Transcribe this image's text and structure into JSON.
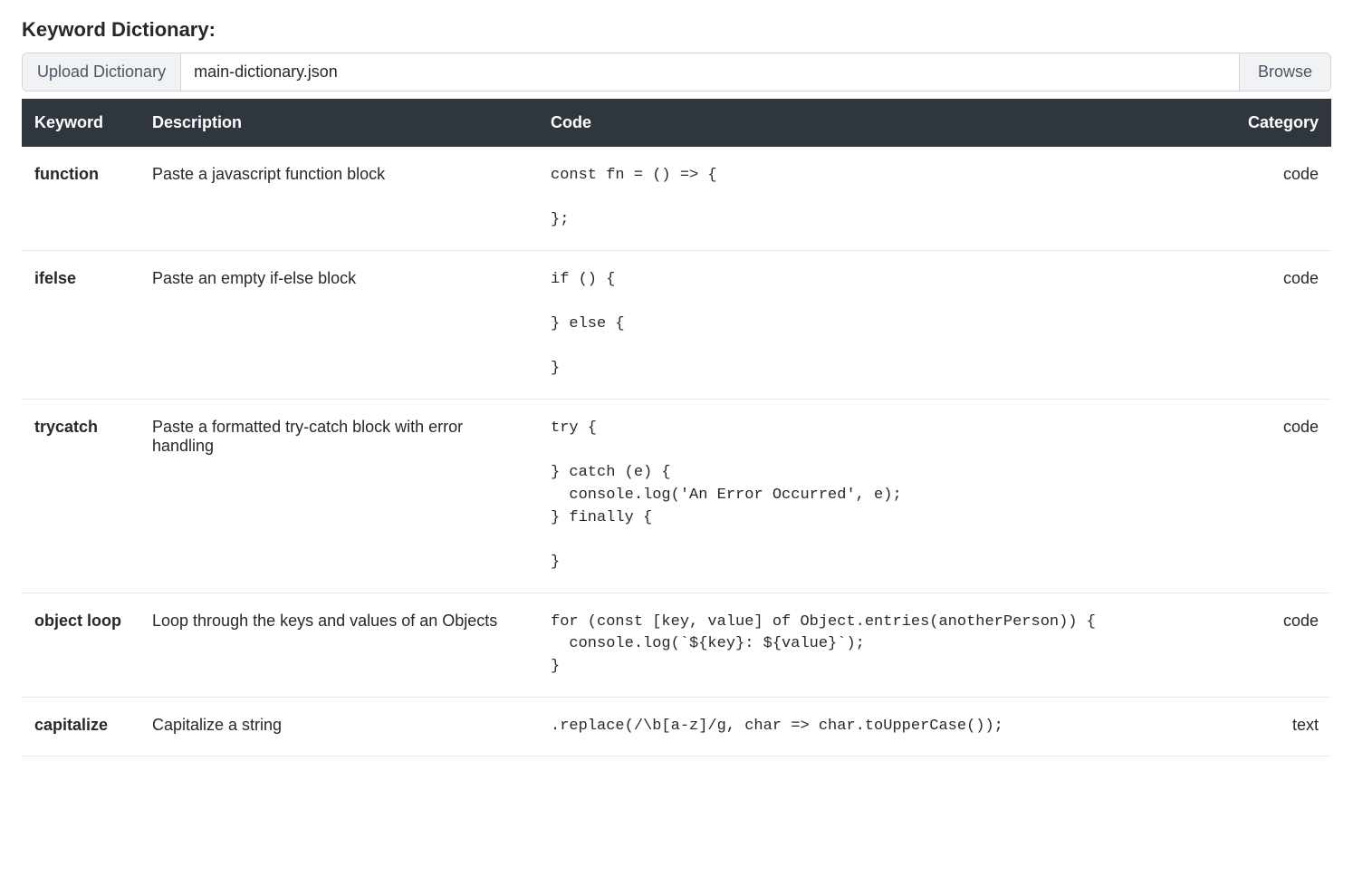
{
  "heading": "Keyword Dictionary:",
  "upload": {
    "label": "Upload Dictionary",
    "filename": "main-dictionary.json",
    "browse_label": "Browse"
  },
  "columns": {
    "keyword": "Keyword",
    "description": "Description",
    "code": "Code",
    "category": "Category"
  },
  "rows": [
    {
      "keyword": "function",
      "description": "Paste a javascript function block",
      "code": "const fn = () => {\n\n};",
      "category": "code"
    },
    {
      "keyword": "ifelse",
      "description": "Paste an empty if-else block",
      "code": "if () {\n\n} else {\n\n}",
      "category": "code"
    },
    {
      "keyword": "trycatch",
      "description": "Paste a formatted try-catch block with error handling",
      "code": "try {\n\n} catch (e) {\n  console.log('An Error Occurred', e);\n} finally {\n\n}",
      "category": "code"
    },
    {
      "keyword": "object loop",
      "description": "Loop through the keys and values of an Objects",
      "code": "for (const [key, value] of Object.entries(anotherPerson)) {\n  console.log(`${key}: ${value}`);\n}",
      "category": "code"
    },
    {
      "keyword": "capitalize",
      "description": "Capitalize a string",
      "code": ".replace(/\\b[a-z]/g, char => char.toUpperCase());",
      "category": "text"
    }
  ]
}
